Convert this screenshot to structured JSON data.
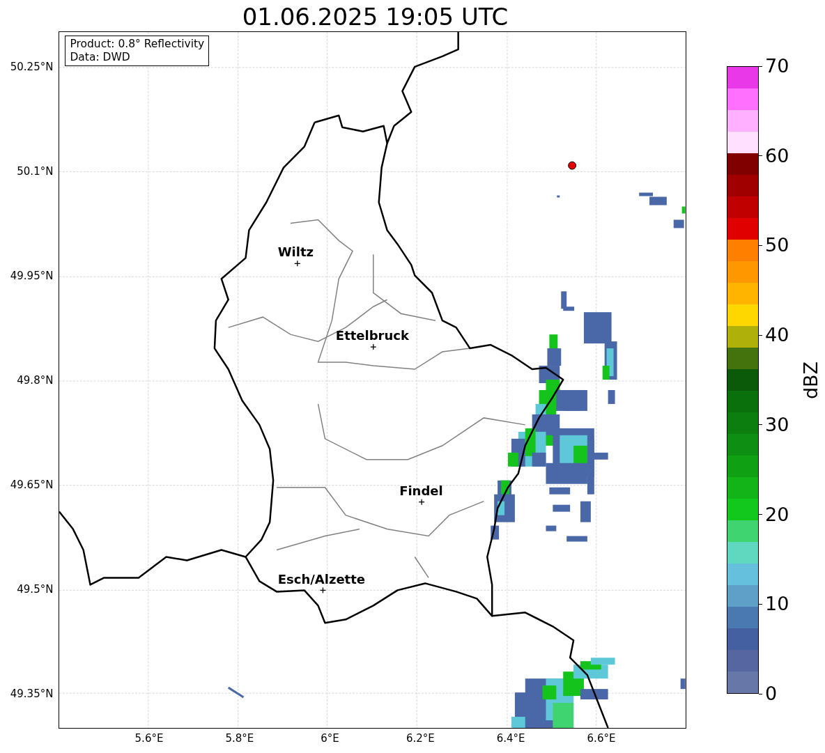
{
  "title": "01.06.2025 19:05 UTC",
  "info_box": {
    "lines": [
      "Product: 0.8° Reflectivity",
      "Data: DWD"
    ]
  },
  "map": {
    "lat_ticks": [
      "50.25°N",
      "50.1°N",
      "49.95°N",
      "49.8°N",
      "49.65°N",
      "49.5°N",
      "49.35°N"
    ],
    "lon_ticks": [
      "5.6°E",
      "5.8°E",
      "6°E",
      "6.2°E",
      "6.4°E",
      "6.6°E"
    ],
    "places": [
      {
        "name": "Wiltz"
      },
      {
        "name": "Ettelbruck"
      },
      {
        "name": "Findel"
      },
      {
        "name": "Esch/Alzette"
      }
    ]
  },
  "colorbar": {
    "label": "dBZ",
    "ticks": [
      "70",
      "60",
      "50",
      "40",
      "30",
      "20",
      "10",
      "0"
    ],
    "segments": [
      {
        "color": "#e838e8"
      },
      {
        "color": "#ff70ff"
      },
      {
        "color": "#ffb0ff"
      },
      {
        "color": "#ffe0ff"
      },
      {
        "color": "#800000"
      },
      {
        "color": "#a00000"
      },
      {
        "color": "#c00000"
      },
      {
        "color": "#e00000"
      },
      {
        "color": "#ff7f00"
      },
      {
        "color": "#ff9800"
      },
      {
        "color": "#ffb400"
      },
      {
        "color": "#ffd700"
      },
      {
        "color": "#b0b00a"
      },
      {
        "color": "#44720c"
      },
      {
        "color": "#0a5a0a"
      },
      {
        "color": "#0a700c"
      },
      {
        "color": "#0c7e10"
      },
      {
        "color": "#0e8e12"
      },
      {
        "color": "#0fa014"
      },
      {
        "color": "#12b418"
      },
      {
        "color": "#12c81c"
      },
      {
        "color": "#40d470"
      },
      {
        "color": "#60d8c0"
      },
      {
        "color": "#64c0dc"
      },
      {
        "color": "#5ea0c8"
      },
      {
        "color": "#4a78b0"
      },
      {
        "color": "#4460a0"
      },
      {
        "color": "#5566a0"
      },
      {
        "color": "#6677a8"
      }
    ]
  }
}
